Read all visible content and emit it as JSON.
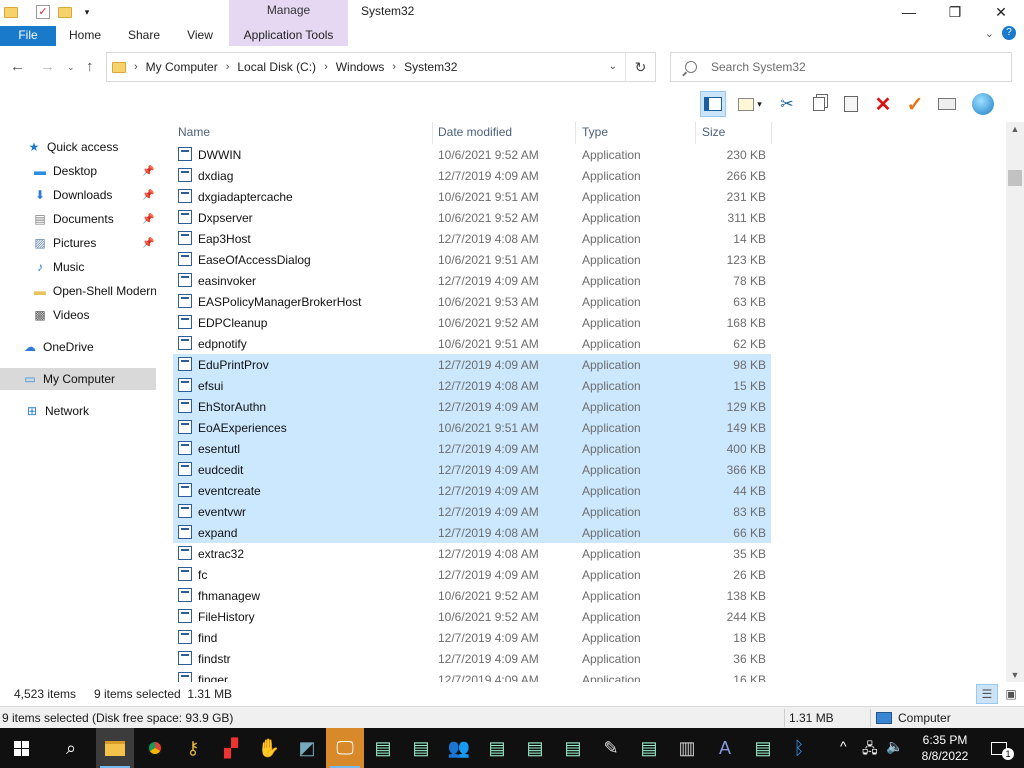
{
  "window": {
    "title": "System32",
    "context_tab": "Manage",
    "minimize": "—",
    "maximize": "❐",
    "close": "✕"
  },
  "ribbon": {
    "tabs": [
      "File",
      "Home",
      "Share",
      "View",
      "Application Tools"
    ],
    "help": "?"
  },
  "address": {
    "crumbs": [
      "My Computer",
      "Local Disk (C:)",
      "Windows",
      "System32"
    ],
    "search_placeholder": "Search System32"
  },
  "sidebar": {
    "items": [
      {
        "label": "Quick access",
        "icon": "star-icon"
      },
      {
        "label": "Desktop",
        "icon": "desktop-icon",
        "pinned": true
      },
      {
        "label": "Downloads",
        "icon": "download-icon",
        "pinned": true
      },
      {
        "label": "Documents",
        "icon": "documents-icon",
        "pinned": true
      },
      {
        "label": "Pictures",
        "icon": "pictures-icon",
        "pinned": true
      },
      {
        "label": "Music",
        "icon": "music-icon"
      },
      {
        "label": "Open-Shell Modern",
        "icon": "folder-icon"
      },
      {
        "label": "Videos",
        "icon": "videos-icon"
      },
      {
        "label": "OneDrive",
        "icon": "cloud-icon"
      },
      {
        "label": "My Computer",
        "icon": "computer-icon",
        "selected": true
      },
      {
        "label": "Network",
        "icon": "network-icon"
      }
    ]
  },
  "columns": {
    "name": "Name",
    "date": "Date modified",
    "type": "Type",
    "size": "Size"
  },
  "files": [
    {
      "name": "DWWIN",
      "date": "10/6/2021 9:52 AM",
      "type": "Application",
      "size": "230 KB",
      "selected": false
    },
    {
      "name": "dxdiag",
      "date": "12/7/2019 4:09 AM",
      "type": "Application",
      "size": "266 KB",
      "selected": false
    },
    {
      "name": "dxgiadaptercache",
      "date": "10/6/2021 9:51 AM",
      "type": "Application",
      "size": "231 KB",
      "selected": false
    },
    {
      "name": "Dxpserver",
      "date": "10/6/2021 9:52 AM",
      "type": "Application",
      "size": "311 KB",
      "selected": false
    },
    {
      "name": "Eap3Host",
      "date": "12/7/2019 4:08 AM",
      "type": "Application",
      "size": "14 KB",
      "selected": false
    },
    {
      "name": "EaseOfAccessDialog",
      "date": "10/6/2021 9:51 AM",
      "type": "Application",
      "size": "123 KB",
      "selected": false
    },
    {
      "name": "easinvoker",
      "date": "12/7/2019 4:09 AM",
      "type": "Application",
      "size": "78 KB",
      "selected": false
    },
    {
      "name": "EASPolicyManagerBrokerHost",
      "date": "10/6/2021 9:53 AM",
      "type": "Application",
      "size": "63 KB",
      "selected": false
    },
    {
      "name": "EDPCleanup",
      "date": "10/6/2021 9:52 AM",
      "type": "Application",
      "size": "168 KB",
      "selected": false
    },
    {
      "name": "edpnotify",
      "date": "10/6/2021 9:51 AM",
      "type": "Application",
      "size": "62 KB",
      "selected": false
    },
    {
      "name": "EduPrintProv",
      "date": "12/7/2019 4:09 AM",
      "type": "Application",
      "size": "98 KB",
      "selected": true
    },
    {
      "name": "efsui",
      "date": "12/7/2019 4:08 AM",
      "type": "Application",
      "size": "15 KB",
      "selected": true
    },
    {
      "name": "EhStorAuthn",
      "date": "12/7/2019 4:09 AM",
      "type": "Application",
      "size": "129 KB",
      "selected": true
    },
    {
      "name": "EoAExperiences",
      "date": "10/6/2021 9:51 AM",
      "type": "Application",
      "size": "149 KB",
      "selected": true
    },
    {
      "name": "esentutl",
      "date": "12/7/2019 4:09 AM",
      "type": "Application",
      "size": "400 KB",
      "selected": true
    },
    {
      "name": "eudcedit",
      "date": "12/7/2019 4:09 AM",
      "type": "Application",
      "size": "366 KB",
      "selected": true
    },
    {
      "name": "eventcreate",
      "date": "12/7/2019 4:09 AM",
      "type": "Application",
      "size": "44 KB",
      "selected": true
    },
    {
      "name": "eventvwr",
      "date": "12/7/2019 4:09 AM",
      "type": "Application",
      "size": "83 KB",
      "selected": true
    },
    {
      "name": "expand",
      "date": "12/7/2019 4:08 AM",
      "type": "Application",
      "size": "66 KB",
      "selected": true
    },
    {
      "name": "extrac32",
      "date": "12/7/2019 4:08 AM",
      "type": "Application",
      "size": "35 KB",
      "selected": false
    },
    {
      "name": "fc",
      "date": "12/7/2019 4:09 AM",
      "type": "Application",
      "size": "26 KB",
      "selected": false
    },
    {
      "name": "fhmanagew",
      "date": "10/6/2021 9:52 AM",
      "type": "Application",
      "size": "138 KB",
      "selected": false
    },
    {
      "name": "FileHistory",
      "date": "10/6/2021 9:52 AM",
      "type": "Application",
      "size": "244 KB",
      "selected": false
    },
    {
      "name": "find",
      "date": "12/7/2019 4:09 AM",
      "type": "Application",
      "size": "18 KB",
      "selected": false
    },
    {
      "name": "findstr",
      "date": "12/7/2019 4:09 AM",
      "type": "Application",
      "size": "36 KB",
      "selected": false
    },
    {
      "name": "finger",
      "date": "12/7/2019 4:09 AM",
      "type": "Application",
      "size": "16 KB",
      "selected": false
    }
  ],
  "status": {
    "item_count": "4,523 items",
    "selected": "9 items selected  1.31 MB"
  },
  "classic_status": {
    "left": "9 items selected (Disk free space: 93.9 GB)",
    "size": "1.31 MB",
    "location": "Computer"
  },
  "taskbar": {
    "time": "6:35 PM",
    "date": "8/8/2022",
    "notification_count": "1"
  },
  "colors": {
    "file_tab": "#1979ca",
    "manage_tab": "#e6d8f3",
    "selection": "#cce8ff",
    "taskbar": "#101010"
  }
}
